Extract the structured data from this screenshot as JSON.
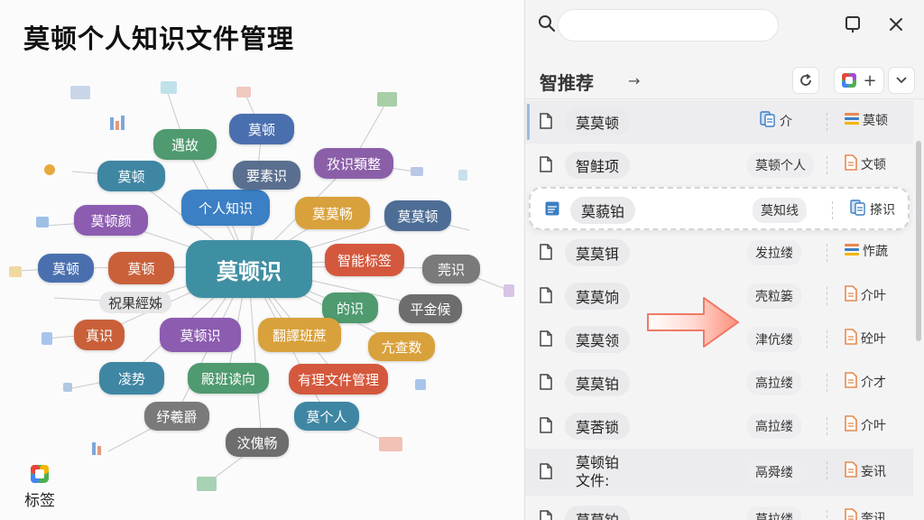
{
  "left": {
    "title": "莫顿个人知识文件管理",
    "bottom_button_label": "标签",
    "tags": [
      {
        "text": "莫顿识",
        "color": "#3f8fa3",
        "center": true
      },
      {
        "text": "个人知识",
        "color": "#3b7fc4"
      },
      {
        "text": "莫顿",
        "color": "#4a6fae"
      },
      {
        "text": "遇故",
        "color": "#4f9a6f"
      },
      {
        "text": "莫顿",
        "color": "#3f86a3"
      },
      {
        "text": "要素识",
        "color": "#5a6f8f"
      },
      {
        "text": "孜识類整",
        "color": "#8b5fa8"
      },
      {
        "text": "莫顿颜",
        "color": "#8c5cb0"
      },
      {
        "text": "莫莫畅",
        "color": "#d9a13b"
      },
      {
        "text": "莫莫顿",
        "color": "#4d6d96"
      },
      {
        "text": "莫顿",
        "color": "#4a6fae"
      },
      {
        "text": "莫顿",
        "color": "#c9603a"
      },
      {
        "text": "智能标签",
        "color": "#d4583d"
      },
      {
        "text": "莞识",
        "color": "#7a7a7a"
      },
      {
        "text": "祝果經姊",
        "color": "#e7e7e9",
        "light": true
      },
      {
        "text": "的识",
        "color": "#4f9a6f"
      },
      {
        "text": "平金候",
        "color": "#6d6d6d"
      },
      {
        "text": "真识",
        "color": "#c9603a"
      },
      {
        "text": "莫顿识",
        "color": "#8c5cb0"
      },
      {
        "text": "翻譯班蔗",
        "color": "#d9a13b"
      },
      {
        "text": "亢查数",
        "color": "#d9a13b"
      },
      {
        "text": "凌势",
        "color": "#3f86a3"
      },
      {
        "text": "殿班读向",
        "color": "#4f9a6f"
      },
      {
        "text": "有理文件管理",
        "color": "#d4583d"
      },
      {
        "text": "纾羲爵",
        "color": "#7a7a7a"
      },
      {
        "text": "莫个人",
        "color": "#3f86a3"
      },
      {
        "text": "汶傀畅",
        "color": "#6d6d6d"
      }
    ]
  },
  "right": {
    "search": {
      "placeholder": "",
      "value": ""
    },
    "section_title": "智推荐",
    "section_arrow": "→",
    "plus_label": "+",
    "rows": [
      {
        "name": "莫莫顿",
        "category": "",
        "type_label": "介",
        "type2": "莫顿",
        "selected": true
      },
      {
        "name": "智鲑项",
        "category": "莫顿个人",
        "type_label": "文顿"
      },
      {
        "name": "莫藐铂",
        "category": "莫知线",
        "type_label": "搽识",
        "highlight": true
      },
      {
        "name": "莫莫铒",
        "category": "发拉缕",
        "type_label": "怍蔬"
      },
      {
        "name": "莫莫饷",
        "category": "壳粒篓",
        "type_label": "介叶"
      },
      {
        "name": "莫莫领",
        "category": "津伉缕",
        "type_label": "砼叶"
      },
      {
        "name": "莫莫铂",
        "category": "高拉缕",
        "type_label": "介才"
      },
      {
        "name": "莫莕锁",
        "category": "高拉缕",
        "type_label": "介叶"
      },
      {
        "name": "莫顿铂\n文件:",
        "category": "鬲舜缕",
        "type_label": "妄讯",
        "gray": true
      },
      {
        "name": "莫莫铂",
        "category": "莫拉缕",
        "type_label": "奎讯"
      }
    ]
  }
}
